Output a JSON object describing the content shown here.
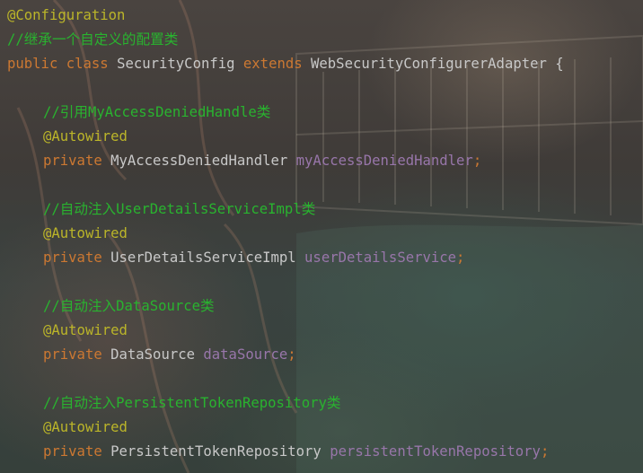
{
  "code": {
    "l1_anno": "@Configuration",
    "l2_comment": "//继承一个自定义的配置类",
    "l3_public": "public",
    "l3_class": "class",
    "l3_name": "SecurityConfig",
    "l3_extends": "extends",
    "l3_parent": "WebSecurityConfigurerAdapter",
    "l3_brace": "{",
    "f1_comment": "//引用MyAccessDeniedHandle类",
    "f1_anno": "@Autowired",
    "f1_private": "private",
    "f1_type": "MyAccessDeniedHandler",
    "f1_name": "myAccessDeniedHandler",
    "f2_comment": "//自动注入UserDetailsServiceImpl类",
    "f2_anno": "@Autowired",
    "f2_private": "private",
    "f2_type": "UserDetailsServiceImpl",
    "f2_name": "userDetailsService",
    "f3_comment": "//自动注入DataSource类",
    "f3_anno": "@Autowired",
    "f3_private": "private",
    "f3_type": "DataSource",
    "f3_name": "dataSource",
    "f4_comment": "//自动注入PersistentTokenRepository类",
    "f4_anno": "@Autowired",
    "f4_private": "private",
    "f4_type": "PersistentTokenRepository",
    "f4_name": "persistentTokenRepository",
    "semicolon": ";"
  },
  "colors": {
    "annotation": "#bbb529",
    "comment": "#29b32f",
    "keyword": "#cc7832",
    "field": "#9876aa",
    "text": "#c8c8c8"
  }
}
